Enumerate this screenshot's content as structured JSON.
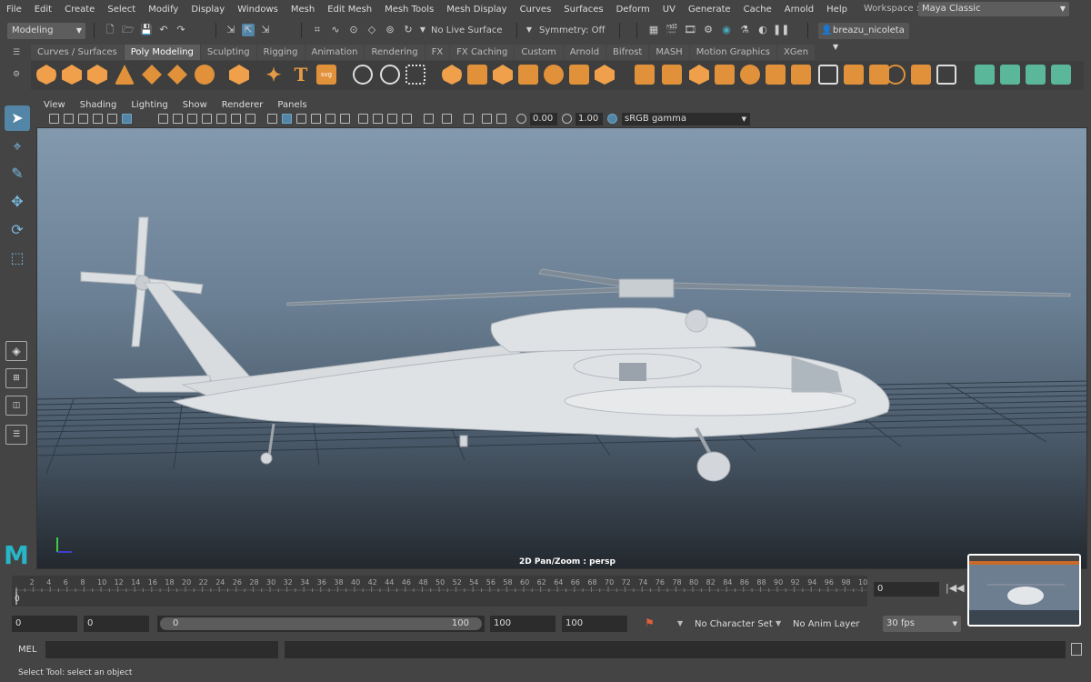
{
  "menubar": {
    "items": [
      "File",
      "Edit",
      "Create",
      "Select",
      "Modify",
      "Display",
      "Windows",
      "Mesh",
      "Edit Mesh",
      "Mesh Tools",
      "Mesh Display",
      "Curves",
      "Surfaces",
      "Deform",
      "UV",
      "Generate",
      "Cache",
      "Arnold",
      "Help"
    ],
    "workspace_label": "Workspace :",
    "workspace_value": "Maya Classic"
  },
  "statusline": {
    "mode": "Modeling",
    "live_surface": "No Live Surface",
    "symmetry": "Symmetry: Off",
    "user": "breazu_nicoleta"
  },
  "shelf": {
    "tabs": [
      "Curves / Surfaces",
      "Poly Modeling",
      "Sculpting",
      "Rigging",
      "Animation",
      "Rendering",
      "FX",
      "FX Caching",
      "Custom",
      "Arnold",
      "Bifrost",
      "MASH",
      "Motion Graphics",
      "XGen"
    ],
    "active_tab": "Poly Modeling"
  },
  "panel": {
    "menus": [
      "View",
      "Shading",
      "Lighting",
      "Show",
      "Renderer",
      "Panels"
    ],
    "exposure": "0.00",
    "gamma": "1.00",
    "colorspace": "sRGB gamma",
    "camera_label": "2D Pan/Zoom : persp"
  },
  "timeslider": {
    "ticks": [
      "2",
      "4",
      "6",
      "8",
      "10",
      "12",
      "14",
      "16",
      "18",
      "20",
      "22",
      "24",
      "26",
      "28",
      "30",
      "32",
      "34",
      "36",
      "38",
      "40",
      "42",
      "44",
      "46",
      "48",
      "50",
      "52",
      "54",
      "56",
      "58",
      "60",
      "62",
      "64",
      "66",
      "68",
      "70",
      "72",
      "74",
      "76",
      "78",
      "80",
      "82",
      "84",
      "86",
      "88",
      "90",
      "92",
      "94",
      "96",
      "98",
      "10"
    ],
    "start_label": "0",
    "current_frame": "0"
  },
  "range": {
    "anim_start": "0",
    "start": "0",
    "slider_start": "0",
    "slider_end": "100",
    "end": "100",
    "anim_end": "100",
    "character_set": "No Character Set",
    "anim_layer": "No Anim Layer",
    "fps": "30 fps"
  },
  "commandline": {
    "label": "MEL",
    "help": "Select Tool: select an object"
  },
  "colors": {
    "accent": "#5285a6",
    "shelf_orange": "#e0913a",
    "shelf_teal": "#5bb79a",
    "maya_logo": "#27b5c7"
  }
}
